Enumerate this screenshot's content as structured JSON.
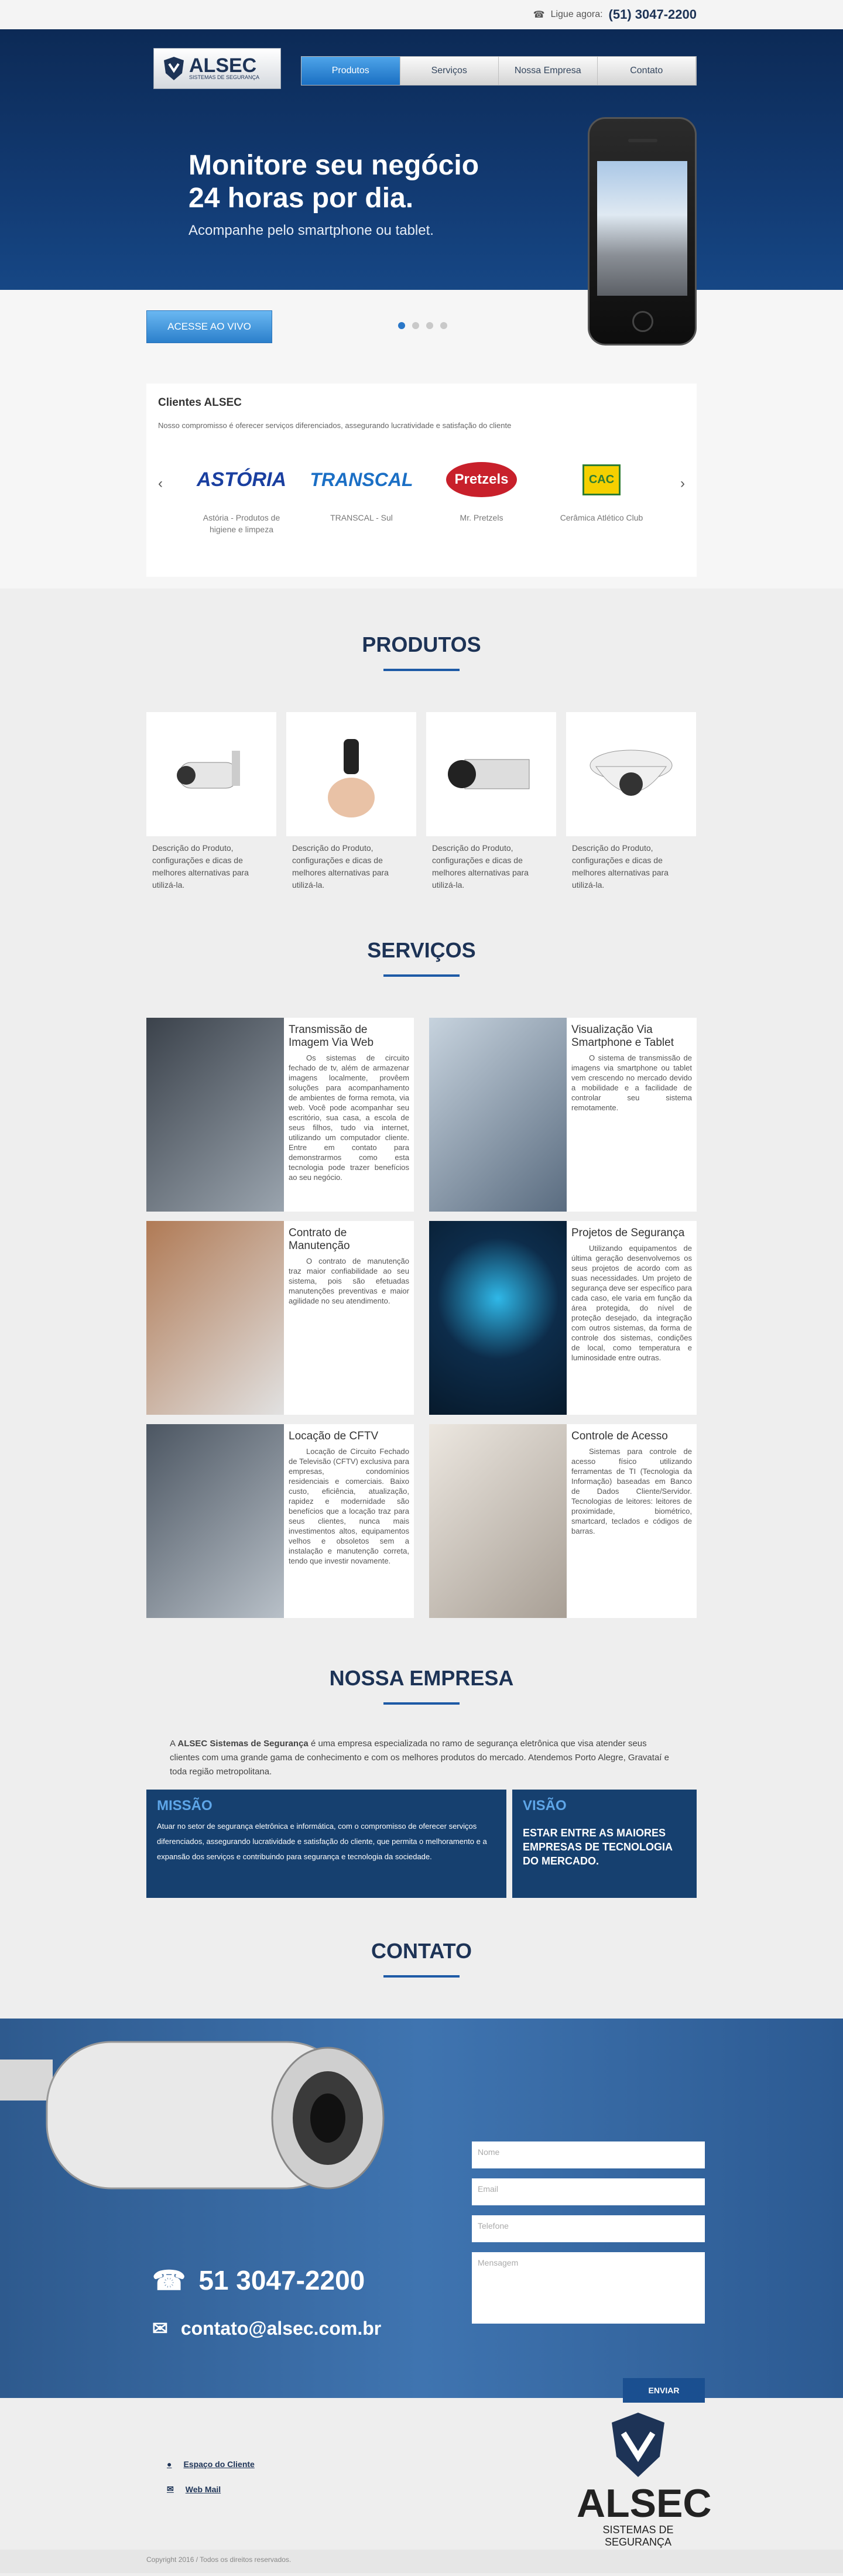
{
  "topbar": {
    "phone_label": "Ligue agora:",
    "phone": "(51) 3047-2200"
  },
  "logo": {
    "name": "ALSEC",
    "tagline": "SISTEMAS DE SEGURANÇA"
  },
  "nav": [
    {
      "label": "Produtos",
      "active": true
    },
    {
      "label": "Serviços"
    },
    {
      "label": "Nossa Empresa"
    },
    {
      "label": "Contato"
    }
  ],
  "hero": {
    "headline1": "Monitore seu negócio",
    "headline2": "24 horas por dia.",
    "subtitle": "Acompanhe pelo smartphone ou tablet.",
    "cta": "ACESSE AO VIVO",
    "slides": 4,
    "active_slide": 1
  },
  "clients": {
    "title": "Clientes ALSEC",
    "description": "Nosso compromisso é oferecer serviços diferenciados, assegurando lucratividade e satisfação do cliente",
    "items": [
      {
        "logo_text": "ASTÓRIA",
        "caption": "Astória - Produtos de higiene e limpeza",
        "color": "#1a3fa0"
      },
      {
        "logo_text": "TRANSCAL",
        "caption": "TRANSCAL - Sul",
        "color": "#1b6fc5"
      },
      {
        "logo_text": "Pretzels",
        "caption": "Mr. Pretzels",
        "color": "#c8202b"
      },
      {
        "logo_text": "CAC",
        "caption": "Cerâmica Atlético Club",
        "color": "#2e7d32"
      }
    ]
  },
  "produtos": {
    "title": "PRODUTOS",
    "items": [
      {
        "icon": "bullet-camera-icon",
        "desc": "Descrição do Produto, configurações e dicas de melhores alternativas para utilizá-la."
      },
      {
        "icon": "mini-camera-icon",
        "desc": "Descrição do Produto, configurações e dicas de melhores alternativas para utilizá-la."
      },
      {
        "icon": "box-camera-icon",
        "desc": "Descrição do Produto, configurações e dicas de melhores alternativas para utilizá-la."
      },
      {
        "icon": "dome-camera-icon",
        "desc": "Descrição do Produto, configurações e dicas de melhores alternativas para utilizá-la."
      }
    ]
  },
  "servicos": {
    "title": "SERVIÇOS",
    "items": [
      {
        "title": "Transmissão de Imagem Via Web",
        "text": "Os sistemas de circuito fechado de tv, além de armazenar imagens localmente, provêem soluções para acompanhamento de ambientes de forma remota, via web. Você pode acompanhar seu escritório, sua casa, a escola de seus filhos, tudo via internet, utilizando um computador cliente. Entre em contato para demonstrarmos como esta tecnologia pode trazer benefícios ao seu negócio.",
        "img_color": "#5b6570"
      },
      {
        "title": "Visualização Via Smartphone e Tablet",
        "text": "O sistema de transmissão de imagens via smartphone ou tablet vem crescendo no mercado devido a mobilidade e a facilidade de controlar seu sistema remotamente.",
        "img_color": "#8d9aa8"
      },
      {
        "title": "Contrato de Manutenção",
        "text": "O contrato de manutenção traz maior confiabilidade ao seu sistema, pois são efetuadas manutenções preventivas e maior agilidade no seu atendimento.",
        "img_color": "#9b6a4a"
      },
      {
        "title": "Projetos de Segurança",
        "text": "Utilizando equipamentos de última geração desenvolvemos os seus projetos de acordo com as suas necessidades. Um projeto de segurança deve ser específico para cada caso, ele varia em função da área protegida, do nível de proteção desejado, da integração com outros sistemas, da forma de controle dos sistemas, condições de local, como temperatura e luminosidade entre outras.",
        "img_color": "#0f2a44"
      },
      {
        "title": "Locação de CFTV",
        "text": "Locação de Circuito Fechado de Televisão (CFTV) exclusiva para empresas, condomínios residenciais e comerciais. Baixo custo, eficiência, atualização, rapidez e modernidade são benefícios que a locação traz para seus clientes, nunca mais investimentos altos, equipamentos velhos e obsoletos sem a instalação e manutenção correta, tendo que investir novamente.",
        "img_color": "#6d7884"
      },
      {
        "title": "Controle de Acesso",
        "text": "Sistemas para controle de acesso físico utilizando ferramentas de TI (Tecnologia da Informação) baseadas em Banco de Dados Cliente/Servidor. Tecnologias de leitores: leitores de proximidade, biométrico, smartcard, teclados e códigos de barras.",
        "img_color": "#c9c3bb"
      }
    ]
  },
  "empresa": {
    "title": "NOSSA EMPRESA",
    "intro_prefix": "A ",
    "intro_brand": "ALSEC Sistemas de Segurança",
    "intro_rest": " é uma empresa especializada no ramo de segurança eletrônica que visa atender seus clientes com uma grande gama de conhecimento e com os melhores produtos do mercado. Atendemos Porto Alegre, Gravataí e toda região metropolitana.",
    "missao_title": "MISSÃO",
    "missao_text": "Atuar no setor de segurança eletrônica e informática, com o compromisso de oferecer serviços diferenciados, assegurando lucratividade e satisfação do cliente, que permita o melhoramento e a expansão dos serviços e contribuindo para segurança e tecnologia da sociedade.",
    "visao_title": "VISÃO",
    "visao_text": "ESTAR ENTRE AS MAIORES EMPRESAS DE TECNOLOGIA DO MERCADO."
  },
  "contato": {
    "title": "CONTATO",
    "phone": "51 3047-2200",
    "email": "contato@alsec.com.br",
    "fields": [
      "Nome",
      "Email",
      "Telefone",
      "Mensagem"
    ],
    "send": "ENVIAR"
  },
  "footer": {
    "links": [
      "Espaço do Cliente",
      "Web Mail"
    ],
    "logo_name": "ALSEC",
    "logo_tagline": "SISTEMAS DE SEGURANÇA",
    "copyright": "Copyright 2016 / Todos os direitos reservados."
  }
}
